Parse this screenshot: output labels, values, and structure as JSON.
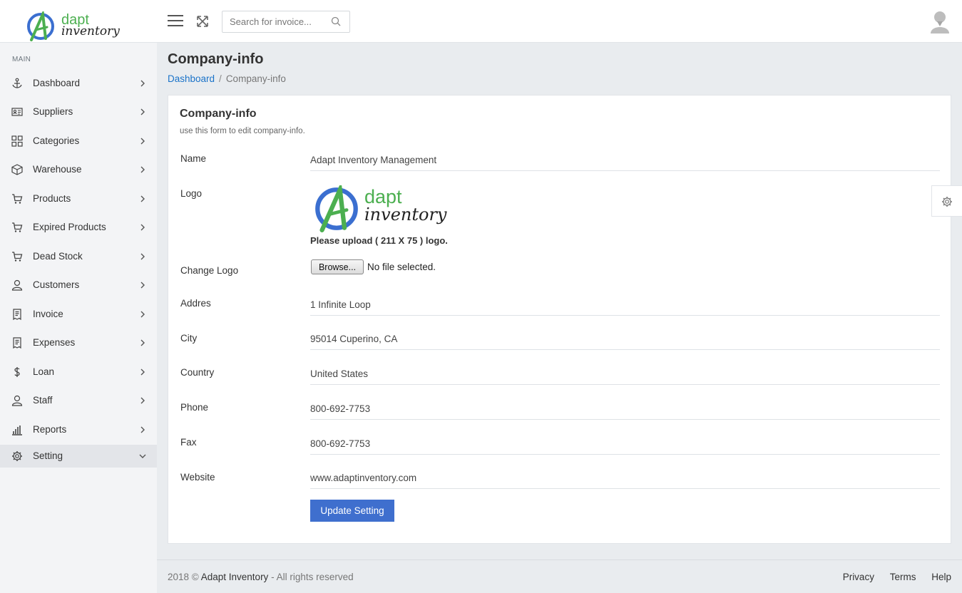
{
  "brand": {
    "word1": "dapt",
    "word2": "inventory"
  },
  "search": {
    "placeholder": "Search for invoice..."
  },
  "sidebar": {
    "section_label": "MAIN",
    "items": [
      {
        "label": "Dashboard",
        "icon": "anchor-icon"
      },
      {
        "label": "Suppliers",
        "icon": "id-card-icon"
      },
      {
        "label": "Categories",
        "icon": "grid-icon"
      },
      {
        "label": "Warehouse",
        "icon": "box-icon"
      },
      {
        "label": "Products",
        "icon": "cart-icon"
      },
      {
        "label": "Expired Products",
        "icon": "cart-icon"
      },
      {
        "label": "Dead Stock",
        "icon": "cart-icon"
      },
      {
        "label": "Customers",
        "icon": "user-icon"
      },
      {
        "label": "Invoice",
        "icon": "receipt-icon"
      },
      {
        "label": "Expenses",
        "icon": "receipt-icon"
      },
      {
        "label": "Loan",
        "icon": "dollar-icon"
      },
      {
        "label": "Staff",
        "icon": "user-icon"
      },
      {
        "label": "Reports",
        "icon": "bar-chart-icon"
      },
      {
        "label": "Setting",
        "icon": "gear-icon",
        "active": true,
        "expanded": true
      }
    ]
  },
  "page": {
    "title": "Company-info",
    "breadcrumb": {
      "home": "Dashboard",
      "separator": "/",
      "current": "Company-info"
    }
  },
  "card": {
    "title": "Company-info",
    "subtitle": "use this form to edit company-info.",
    "fields": {
      "name": {
        "label": "Name",
        "value": "Adapt Inventory Management"
      },
      "logo": {
        "label": "Logo",
        "note": "Please upload ( 211 X 75 ) logo."
      },
      "change_logo": {
        "label": "Change Logo",
        "button": "Browse...",
        "status": "No file selected."
      },
      "address": {
        "label": "Addres",
        "value": "1 Infinite Loop"
      },
      "city": {
        "label": "City",
        "value": "95014 Cuperino, CA"
      },
      "country": {
        "label": "Country",
        "value": "United States"
      },
      "phone": {
        "label": "Phone",
        "value": "800-692-7753"
      },
      "fax": {
        "label": "Fax",
        "value": "800-692-7753"
      },
      "website": {
        "label": "Website",
        "value": "www.adaptinventory.com"
      }
    },
    "submit_label": "Update Setting"
  },
  "footer": {
    "copyright_prefix": "2018 ©",
    "brand": "Adapt Inventory",
    "copyright_suffix": "- All rights reserved",
    "links": [
      "Privacy",
      "Terms",
      "Help"
    ]
  },
  "colors": {
    "primary": "#3f6fce",
    "link": "#1a73c9",
    "logo_green": "#4caf50",
    "logo_blue": "#3b6fd0"
  }
}
